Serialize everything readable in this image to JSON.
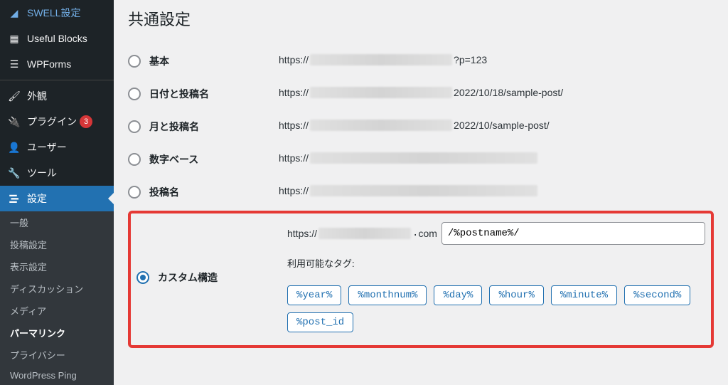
{
  "sidebar": {
    "items": [
      {
        "label": "SWELL設定",
        "icon": "swell"
      },
      {
        "label": "Useful Blocks",
        "icon": "blocks"
      },
      {
        "label": "WPForms",
        "icon": "forms"
      }
    ],
    "items2": [
      {
        "label": "外観",
        "icon": "brush"
      },
      {
        "label": "プラグイン",
        "icon": "plug",
        "badge": "3"
      },
      {
        "label": "ユーザー",
        "icon": "user"
      },
      {
        "label": "ツール",
        "icon": "wrench"
      },
      {
        "label": "設定",
        "icon": "settings",
        "current": true
      }
    ],
    "sub": [
      {
        "label": "一般"
      },
      {
        "label": "投稿設定"
      },
      {
        "label": "表示設定"
      },
      {
        "label": "ディスカッション"
      },
      {
        "label": "メディア"
      },
      {
        "label": "パーマリンク",
        "current": true
      },
      {
        "label": "プライバシー"
      },
      {
        "label": "WordPress Ping"
      }
    ]
  },
  "page": {
    "title": "共通設定",
    "options": [
      {
        "label": "基本",
        "prefix": "https://",
        "suffix": "?p=123"
      },
      {
        "label": "日付と投稿名",
        "prefix": "https://",
        "suffix": "2022/10/18/sample-post/"
      },
      {
        "label": "月と投稿名",
        "prefix": "https://",
        "suffix": "2022/10/sample-post/"
      },
      {
        "label": "数字ベース",
        "prefix": "https://",
        "suffix": ""
      },
      {
        "label": "投稿名",
        "prefix": "https://",
        "suffix": ""
      }
    ],
    "custom": {
      "label": "カスタム構造",
      "prefix": "https://",
      "suffix": "com",
      "input_value": "/%postname%/",
      "available_label": "利用可能なタグ:",
      "tags": [
        "%year%",
        "%monthnum%",
        "%day%",
        "%hour%",
        "%minute%",
        "%second%",
        "%post_id"
      ]
    }
  }
}
